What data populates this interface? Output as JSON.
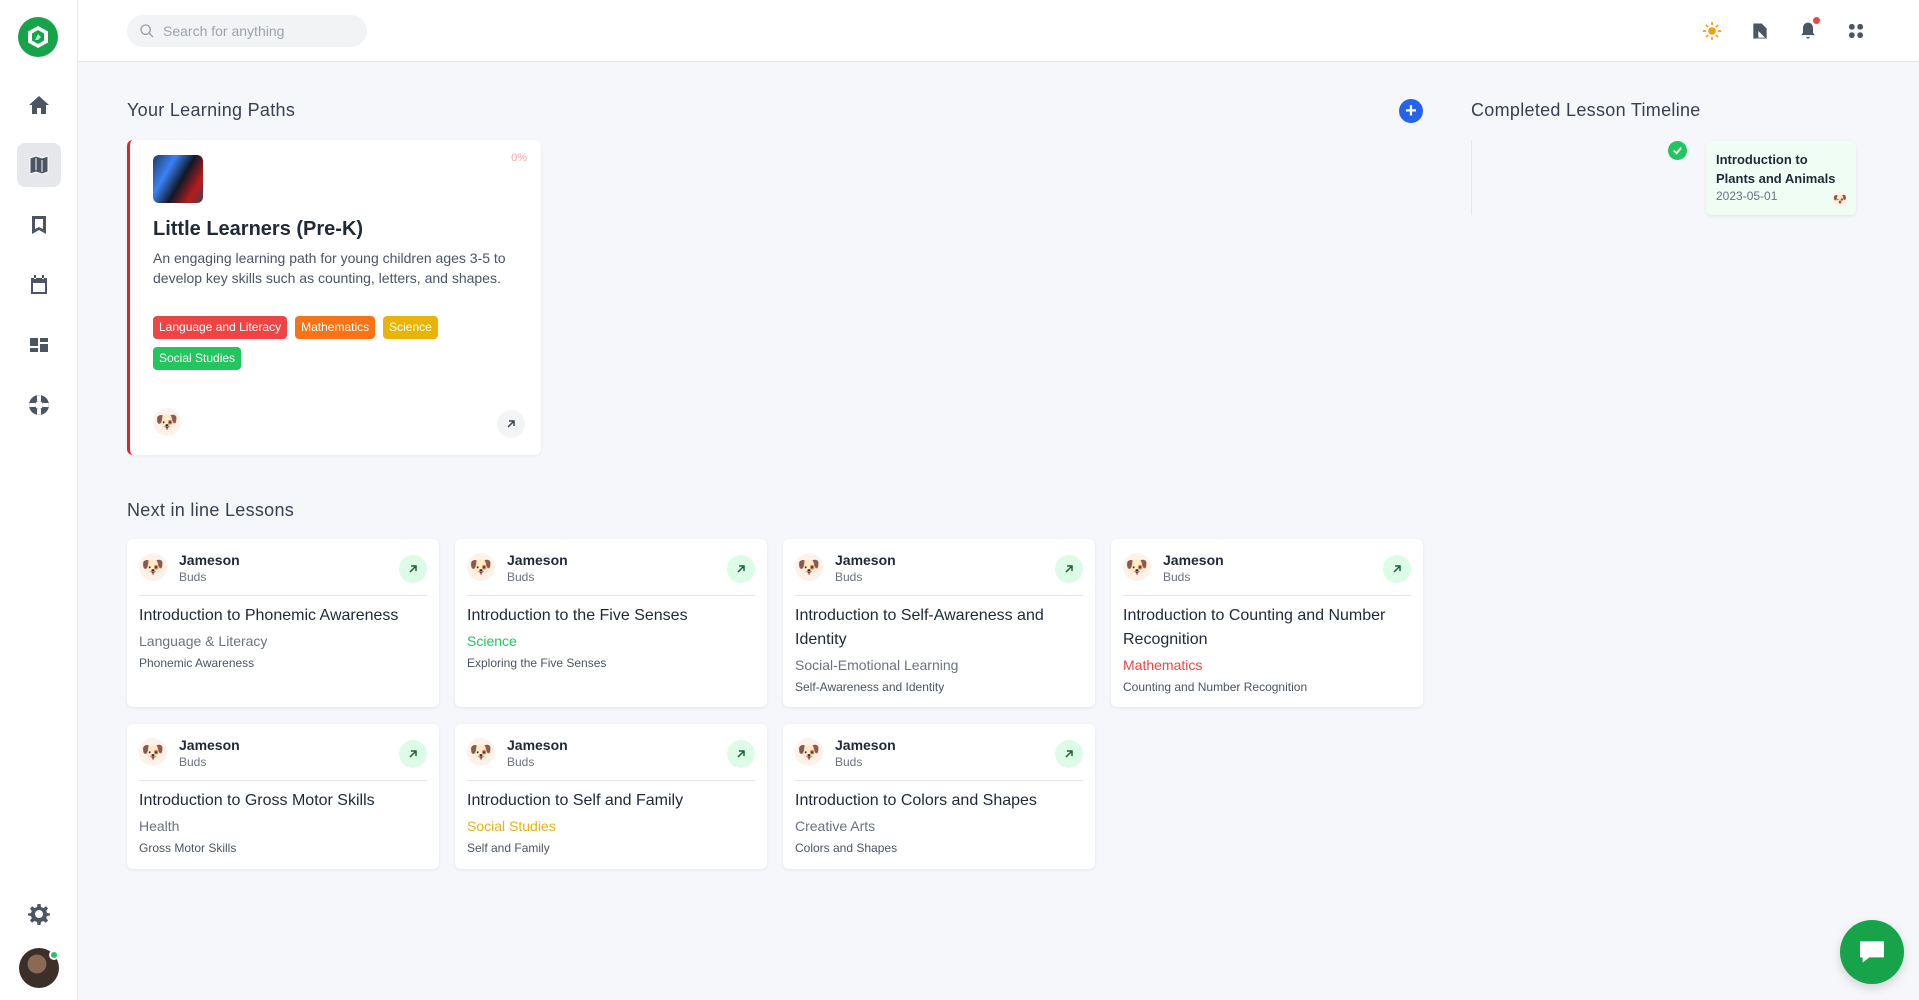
{
  "header": {
    "search_placeholder": "Search for anything"
  },
  "sidebar": {
    "items": [
      {
        "name": "home-icon",
        "active": false
      },
      {
        "name": "map-icon",
        "active": true
      },
      {
        "name": "bookmark-icon",
        "active": false
      },
      {
        "name": "calendar-icon",
        "active": false
      },
      {
        "name": "dashboard-icon",
        "active": false
      },
      {
        "name": "lifebuoy-icon",
        "active": false
      }
    ]
  },
  "learning_paths": {
    "title": "Your Learning Paths",
    "cards": [
      {
        "progress": "0%",
        "title": "Little Learners (Pre-K)",
        "description": "An engaging learning path for young children ages 3-5 to develop key skills such as counting, letters, and shapes.",
        "tags": [
          {
            "label": "Language and Literacy",
            "color": "#ef4444"
          },
          {
            "label": "Mathematics",
            "color": "#f97316"
          },
          {
            "label": "Science",
            "color": "#eab308"
          },
          {
            "label": "Social Studies",
            "color": "#22c55e"
          }
        ]
      }
    ]
  },
  "timeline": {
    "title": "Completed Lesson Timeline",
    "items": [
      {
        "title": "Introduction to Plants and Animals",
        "date": "2023-05-01"
      }
    ]
  },
  "next_lessons": {
    "title": "Next in line Lessons",
    "items": [
      {
        "author": "Jameson",
        "group": "Buds",
        "title": "Introduction to Phonemic Awareness",
        "subject": "Language & Literacy",
        "subject_color": "#6b7280",
        "topic": "Phonemic Awareness"
      },
      {
        "author": "Jameson",
        "group": "Buds",
        "title": "Introduction to the Five Senses",
        "subject": "Science",
        "subject_color": "#22c55e",
        "topic": "Exploring the Five Senses"
      },
      {
        "author": "Jameson",
        "group": "Buds",
        "title": "Introduction to Self-Awareness and Identity",
        "subject": "Social-Emotional Learning",
        "subject_color": "#6b7280",
        "topic": "Self-Awareness and Identity"
      },
      {
        "author": "Jameson",
        "group": "Buds",
        "title": "Introduction to Counting and Number Recognition",
        "subject": "Mathematics",
        "subject_color": "#ef4444",
        "topic": "Counting and Number Recognition"
      },
      {
        "author": "Jameson",
        "group": "Buds",
        "title": "Introduction to Gross Motor Skills",
        "subject": "Health",
        "subject_color": "#6b7280",
        "topic": "Gross Motor Skills"
      },
      {
        "author": "Jameson",
        "group": "Buds",
        "title": "Introduction to Self and Family",
        "subject": "Social Studies",
        "subject_color": "#eab308",
        "topic": "Self and Family"
      },
      {
        "author": "Jameson",
        "group": "Buds",
        "title": "Introduction to Colors and Shapes",
        "subject": "Creative Arts",
        "subject_color": "#6b7280",
        "topic": "Colors and Shapes"
      }
    ]
  }
}
